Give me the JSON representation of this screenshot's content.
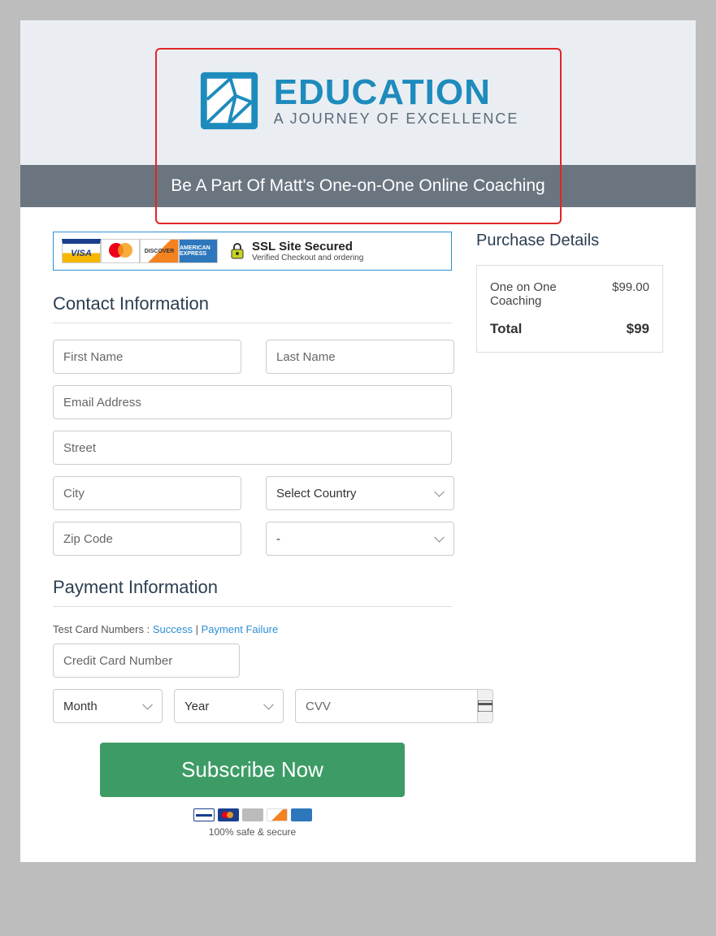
{
  "header": {
    "logo_title": "EDUCATION",
    "logo_subtitle": "A JOURNEY OF EXCELLENCE",
    "banner": "Be A Part Of Matt's One-on-One Online Coaching"
  },
  "ssl": {
    "title": "SSL Site Secured",
    "sub": "Verified Checkout and ordering",
    "cards": {
      "visa": "VISA",
      "disc": "DISCOVER",
      "amex": "AMERICAN EXPRESS"
    }
  },
  "sections": {
    "contact": "Contact Information",
    "payment": "Payment Information"
  },
  "placeholders": {
    "first_name": "First Name",
    "last_name": "Last Name",
    "email": "Email Address",
    "street": "Street",
    "city": "City",
    "zip": "Zip Code",
    "country": "Select Country",
    "state": "-",
    "cc": "Credit Card Number",
    "month": "Month",
    "year": "Year",
    "cvv": "CVV"
  },
  "test": {
    "prefix": "Test Card Numbers : ",
    "success": "Success",
    "sep": " | ",
    "failure": "Payment Failure"
  },
  "button": "Subscribe Now",
  "footer_text": "100% safe & secure",
  "purchase": {
    "title": "Purchase Details",
    "item_name": "One on One Coaching",
    "item_price": "$99.00",
    "total_label": "Total",
    "total_value": "$99"
  }
}
